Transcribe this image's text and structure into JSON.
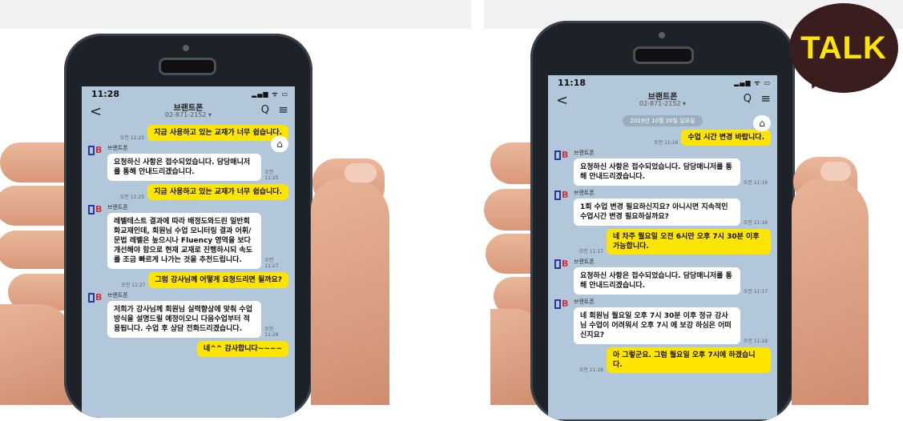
{
  "left_phone": {
    "status": {
      "time": "11:28",
      "icons": "▂▄▆ ᯤ ▭"
    },
    "nav": {
      "back": "<",
      "title": "브랜트폰",
      "phone": "02-871-2152 ▾",
      "search": "Q",
      "menu": "≡"
    },
    "home_icon": "⌂",
    "messages": [
      {
        "dir": "out",
        "time": "오전 11:25",
        "text": "지금 사용하고 있는 교재가 너무 쉽습니다."
      },
      {
        "dir": "in",
        "sender": "브랜트폰",
        "time": "오전 11:25",
        "text": "요청하신 사항은 접수되었습니다. 담당매니저를 통해 안내드리겠습니다."
      },
      {
        "dir": "out",
        "time": "오전 11:25",
        "text": "지금 사용하고 있는 교재가 너무 쉽습니다."
      },
      {
        "dir": "in",
        "sender": "브랜트폰",
        "time": "오전 11:27",
        "text": "레벨테스트 결과에 따라 배정도와드린 일반회화교재인데, 회원님 수업 모니터링 결과 어휘/문법 레벨은 높으시나 Fluency 영역을 보다 개선해야 함으로 현재 교재로 진행하시되 속도를 조금 빠르게 나가는 것을 추천드립니다."
      },
      {
        "dir": "out",
        "time": "오전 11:27",
        "text": "그럼 강사님께 어떻게 요청드리면 될까요?"
      },
      {
        "dir": "in",
        "sender": "브랜트폰",
        "time": "오전 11:28",
        "text": "저희가 강사님께 회원님 실력향상에 맞춰 수업방식을 설명드릴 예정이오니 다음수업부터 적용됩니다. 수업 후 상담 전화드리겠습니다."
      },
      {
        "dir": "out",
        "time": "",
        "text": "네^^ 감사합니다~~~~"
      }
    ]
  },
  "right_phone": {
    "status": {
      "time": "11:18",
      "icons": "▂▄▆ ᯤ ▭"
    },
    "nav": {
      "back": "<",
      "title": "브랜트폰",
      "phone": "02-871-2152 ▾",
      "search": "Q",
      "menu": "≡"
    },
    "date_pill": "2019년 10월 20일 일요일",
    "home_icon": "⌂",
    "messages": [
      {
        "dir": "out",
        "time": "오전 11:16",
        "text": "수업 시간 변경 바랍니다."
      },
      {
        "dir": "in",
        "sender": "브랜트폰",
        "time": "오전 11:16",
        "text": "요청하신 사항은 접수되었습니다. 담당매니저를 통해 안내드리겠습니다."
      },
      {
        "dir": "in",
        "sender": "브랜트폰",
        "time": "오전 11:16",
        "text": "1회 수업 변경 필요하신지요? 아니시면 지속적인 수업시간 변경 필요하실까요?"
      },
      {
        "dir": "out",
        "time": "오전 11:17",
        "text": "네 차주 월요일 오전 6시만 오후 7시 30분 이후 가능합니다."
      },
      {
        "dir": "in",
        "sender": "브랜트폰",
        "time": "오전 11:17",
        "text": "요청하신 사항은 접수되었습니다. 담당매니저를 통해 안내드리겠습니다."
      },
      {
        "dir": "in",
        "sender": "브랜트폰",
        "time": "오전 11:18",
        "text": "네 회원님 월요일 오후 7시 30분 이후 정규 강사님 수업이 어려워서 오후 7시 에 보강 하심은 어떠신지요?"
      },
      {
        "dir": "out",
        "time": "오전 11:18",
        "text": "아 그렇군요. 그럼 월요일 오후 7시에 하겠습니다."
      }
    ]
  },
  "talk_badge": "TALK",
  "colors": {
    "chat_bg": "#b2c7da",
    "bubble_out": "#fee500",
    "bubble_in": "#ffffff",
    "talk_bg": "#3a1d1d",
    "talk_text": "#fee500"
  }
}
